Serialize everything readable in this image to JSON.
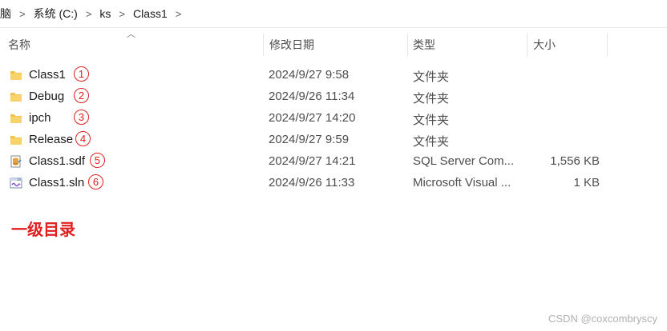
{
  "breadcrumb": [
    "脑",
    "系统 (C:)",
    "ks",
    "Class1"
  ],
  "columns": {
    "name": "名称",
    "date": "修改日期",
    "type": "类型",
    "size": "大小"
  },
  "files": [
    {
      "name": "Class1",
      "date": "2024/9/27 9:58",
      "type": "文件夹",
      "size": "",
      "icon": "folder-icon",
      "marker": "1"
    },
    {
      "name": "Debug",
      "date": "2024/9/26 11:34",
      "type": "文件夹",
      "size": "",
      "icon": "folder-icon",
      "marker": "2"
    },
    {
      "name": "ipch",
      "date": "2024/9/27 14:20",
      "type": "文件夹",
      "size": "",
      "icon": "folder-icon",
      "marker": "3"
    },
    {
      "name": "Release",
      "date": "2024/9/27 9:59",
      "type": "文件夹",
      "size": "",
      "icon": "folder-icon",
      "marker": "4"
    },
    {
      "name": "Class1.sdf",
      "date": "2024/9/27 14:21",
      "type": "SQL Server Com...",
      "size": "1,556 KB",
      "icon": "sdf-file-icon",
      "marker": "5"
    },
    {
      "name": "Class1.sln",
      "date": "2024/9/26 11:33",
      "type": "Microsoft Visual ...",
      "size": "1 KB",
      "icon": "sln-file-icon",
      "marker": "6"
    }
  ],
  "annotation": "一级目录",
  "watermark": "CSDN @coxcombryscy",
  "colors": {
    "annotation": "#e02020",
    "folder": "#f4c34f"
  }
}
